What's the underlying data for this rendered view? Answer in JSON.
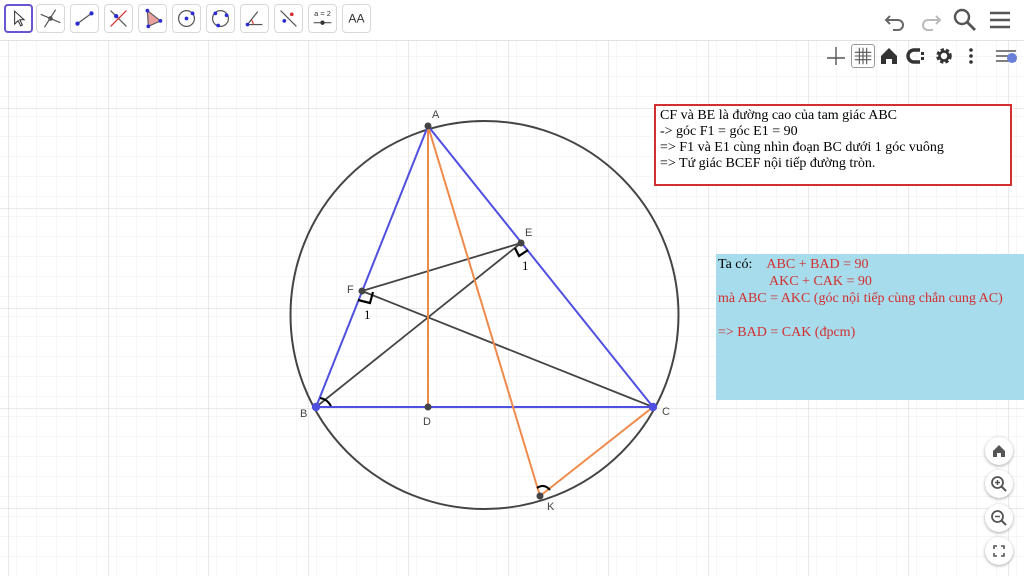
{
  "toolbar": {
    "tools": [
      "move-tool",
      "point-tool",
      "line-tool",
      "perpendicular-tool",
      "polygon-tool",
      "circle-tool",
      "circle-three-points-tool",
      "angle-tool",
      "reflect-tool",
      "slider-tool",
      "text-tool"
    ],
    "slider_icon_text": "a = 2",
    "text_tool_label": "AA"
  },
  "points": {
    "A": "A",
    "B": "B",
    "C": "C",
    "D": "D",
    "E": "E",
    "F": "F",
    "K": "K"
  },
  "angle_labels": {
    "F1": "1",
    "E1": "1"
  },
  "note1": {
    "line1": "CF và BE là đường cao của tam giác ABC",
    "line2": "-> góc F1 = góc E1 = 90",
    "line3": "=> F1 và E1 cùng nhìn đoạn BC dưới 1 góc vuông",
    "line4": "=> Tứ giác BCEF nội tiếp đường tròn."
  },
  "note2": {
    "prefix": "Ta có:",
    "eq1": "ABC + BAD = 90",
    "eq2": "AKC + CAK = 90",
    "line3": "mà ABC = AKC (góc nội tiếp cùng chắn cung AC)",
    "line4": "=> BAD = CAK (đpcm)"
  },
  "colors": {
    "blue": "#4f4fe0",
    "orange": "#f08a4b",
    "gray": "#444444",
    "red": "#d32f2f",
    "note_bg": "#a6dcec"
  }
}
